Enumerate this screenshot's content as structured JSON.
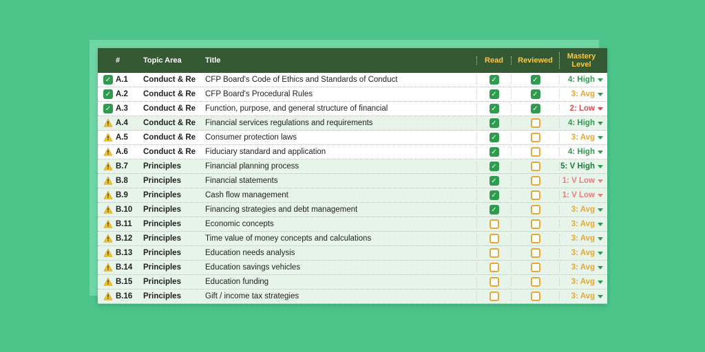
{
  "headers": {
    "num": "#",
    "area": "Topic Area",
    "title": "Title",
    "read": "Read",
    "reviewed": "Reviewed",
    "mastery": "Mastery Level"
  },
  "mastery_levels": {
    "vhigh": "5: V High",
    "high": "4: High",
    "avg": "3: Avg",
    "low": "2: Low",
    "vlow": "1: V Low"
  },
  "rows": [
    {
      "status": "ok",
      "num": "A.1",
      "area": "Conduct & Re",
      "title": "CFP Board's Code of Ethics and Standards of Conduct",
      "read": true,
      "reviewed": true,
      "mastery": "high",
      "band": false
    },
    {
      "status": "ok",
      "num": "A.2",
      "area": "Conduct & Re",
      "title": "CFP Board's Procedural Rules",
      "read": true,
      "reviewed": true,
      "mastery": "avg",
      "band": false
    },
    {
      "status": "ok",
      "num": "A.3",
      "area": "Conduct & Re",
      "title": "Function, purpose, and general structure of financial",
      "read": true,
      "reviewed": true,
      "mastery": "low",
      "band": false
    },
    {
      "status": "warn",
      "num": "A.4",
      "area": "Conduct & Re",
      "title": "Financial services regulations and requirements",
      "read": true,
      "reviewed": false,
      "mastery": "high",
      "band": false
    },
    {
      "status": "warn",
      "num": "A.5",
      "area": "Conduct & Re",
      "title": "Consumer protection laws",
      "read": true,
      "reviewed": false,
      "mastery": "avg",
      "band": false
    },
    {
      "status": "warn",
      "num": "A.6",
      "area": "Conduct & Re",
      "title": "Fiduciary standard and application",
      "read": true,
      "reviewed": false,
      "mastery": "high",
      "band": false
    },
    {
      "status": "warn",
      "num": "B.7",
      "area": "Principles",
      "title": "Financial planning process",
      "read": true,
      "reviewed": false,
      "mastery": "vhigh",
      "band": true
    },
    {
      "status": "warn",
      "num": "B.8",
      "area": "Principles",
      "title": "Financial statements",
      "read": true,
      "reviewed": false,
      "mastery": "vlow",
      "band": true
    },
    {
      "status": "warn",
      "num": "B.9",
      "area": "Principles",
      "title": "Cash flow management",
      "read": true,
      "reviewed": false,
      "mastery": "vlow",
      "band": true
    },
    {
      "status": "warn",
      "num": "B.10",
      "area": "Principles",
      "title": "Financing strategies and debt management",
      "read": true,
      "reviewed": false,
      "mastery": "avg",
      "band": true
    },
    {
      "status": "warn",
      "num": "B.11",
      "area": "Principles",
      "title": "Economic concepts",
      "read": false,
      "reviewed": false,
      "mastery": "avg",
      "band": true
    },
    {
      "status": "warn",
      "num": "B.12",
      "area": "Principles",
      "title": "Time value of money concepts and calculations",
      "read": false,
      "reviewed": false,
      "mastery": "avg",
      "band": true
    },
    {
      "status": "warn",
      "num": "B.13",
      "area": "Principles",
      "title": "Education needs analysis",
      "read": false,
      "reviewed": false,
      "mastery": "avg",
      "band": true
    },
    {
      "status": "warn",
      "num": "B.14",
      "area": "Principles",
      "title": "Education savings vehicles",
      "read": false,
      "reviewed": false,
      "mastery": "avg",
      "band": true
    },
    {
      "status": "warn",
      "num": "B.15",
      "area": "Principles",
      "title": "Education funding",
      "read": false,
      "reviewed": false,
      "mastery": "avg",
      "band": true
    },
    {
      "status": "warn",
      "num": "B.16",
      "area": "Principles",
      "title": "Gift / income tax strategies",
      "read": false,
      "reviewed": false,
      "mastery": "avg",
      "band": true
    }
  ]
}
